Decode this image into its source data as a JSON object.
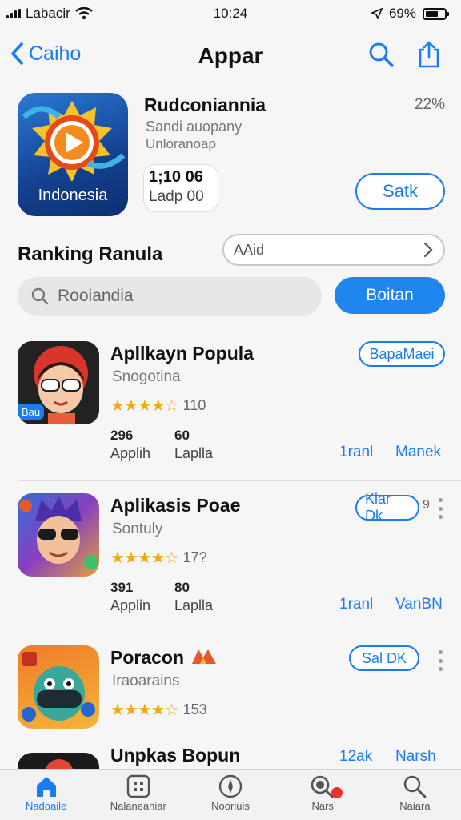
{
  "status_bar": {
    "carrier": "Labacir",
    "time": "10:24",
    "battery_text": "69%",
    "battery_level": 0.69
  },
  "nav": {
    "back_label": "Caiho",
    "title": "Appar"
  },
  "hero": {
    "icon_label": "Indonesia",
    "title": "Rudconiannia",
    "badge": "22%",
    "subtitle1": "Sandi auopany",
    "subtitle2": "Unloranoap",
    "stat_value": "1;10 06",
    "stat_label": "Ladp 00",
    "action_label": "Satk"
  },
  "ranking": {
    "title": "Ranking Ranula",
    "filter_label": "AAid",
    "search_placeholder": "Rooiandia",
    "search_button": "Boitan"
  },
  "apps": [
    {
      "name": "Apllkayn Popula",
      "category": "Snogotina",
      "stars": "★★★★☆",
      "rating": "110",
      "stat1_num": "296",
      "stat1_label": "Applih",
      "stat2_num": "60",
      "stat2_label": "Laplla",
      "link1": "1ranl",
      "link2": "Manek",
      "button": "BapaMaei",
      "icon_badge": "Bau"
    },
    {
      "name": "Aplikasis Poae",
      "category": "Sontuly",
      "stars": "★★★★☆",
      "rating": "17?",
      "stat1_num": "391",
      "stat1_label": "Applin",
      "stat2_num": "80",
      "stat2_label": "Laplla",
      "link1": "1ranl",
      "link2": "VanBN",
      "button": "Klar Dk",
      "side_mark": "9"
    },
    {
      "name": "Poracon",
      "category": "Iraoarains",
      "stars": "★★★★☆",
      "rating": "153",
      "button": "Sal DK"
    }
  ],
  "partial_app": {
    "name": "Unpkas Bopun",
    "link1": "12ak",
    "link2": "Narsh"
  },
  "tabs": [
    {
      "label": "Nadoaile",
      "icon": "home-icon",
      "active": true
    },
    {
      "label": "Nalaneaniar",
      "icon": "grid-icon",
      "active": false
    },
    {
      "label": "Nooriuis",
      "icon": "compass-icon",
      "active": false
    },
    {
      "label": "Nars",
      "icon": "search-badge-icon",
      "active": false
    },
    {
      "label": "Naiara",
      "icon": "search-icon",
      "active": false
    }
  ],
  "colors": {
    "accent": "#1a7cf0",
    "star": "#f2a81d",
    "badge_red": "#e8342a"
  }
}
